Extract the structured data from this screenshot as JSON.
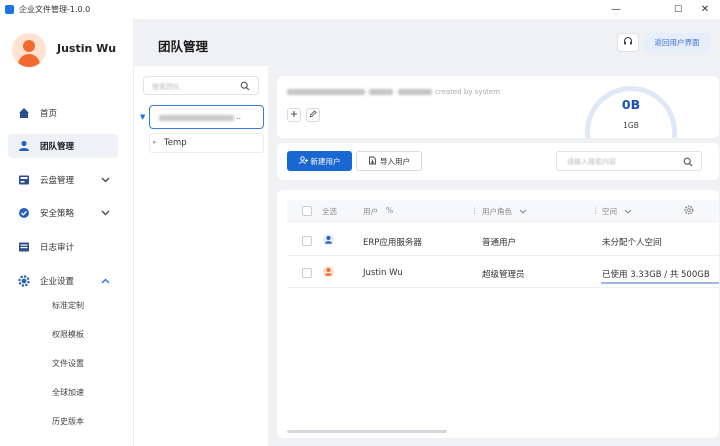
{
  "window": {
    "title": "企业文件管理-1.0.0",
    "minimize": "—",
    "maximize": "☐",
    "close": "✕"
  },
  "user": {
    "name": "Justin Wu"
  },
  "nav": {
    "items": [
      {
        "label": "首页"
      },
      {
        "label": "团队管理"
      },
      {
        "label": "云盘管理"
      },
      {
        "label": "安全策略"
      },
      {
        "label": "日志审计"
      },
      {
        "label": "企业设置"
      }
    ],
    "sub_items": [
      "标准定制",
      "权限模板",
      "文件设置",
      "全球加速",
      "历史版本"
    ]
  },
  "header": {
    "title": "团队管理",
    "back_label": "返回用户界面"
  },
  "tree": {
    "search_placeholder": "搜索团队",
    "selected_suffix": "..",
    "nodes": [
      {
        "label": "Temp"
      }
    ]
  },
  "team_info": {
    "created_by": "created by system",
    "used": "0B",
    "total": "1GB"
  },
  "actions": {
    "new_user": "新建用户",
    "import_user": "导入用户",
    "search_placeholder": "请输入搜索内容"
  },
  "table": {
    "headers": {
      "select_all": "全选",
      "user": "用户",
      "sort_symbol": "%",
      "role": "用户角色",
      "space": "空间"
    },
    "rows": [
      {
        "user": "ERP应用服务器",
        "role": "普通用户",
        "space": "未分配个人空间",
        "icon": "user-blue-icon"
      },
      {
        "user": "Justin Wu",
        "role": "超级管理员",
        "space": "已使用 3.33GB / 共 500GB",
        "icon": "user-orange-icon",
        "usage_fraction": 0.007
      }
    ]
  },
  "colors": {
    "primary": "#1967d2",
    "accent_orange": "#f26a2d",
    "background": "#f0f1f4"
  }
}
